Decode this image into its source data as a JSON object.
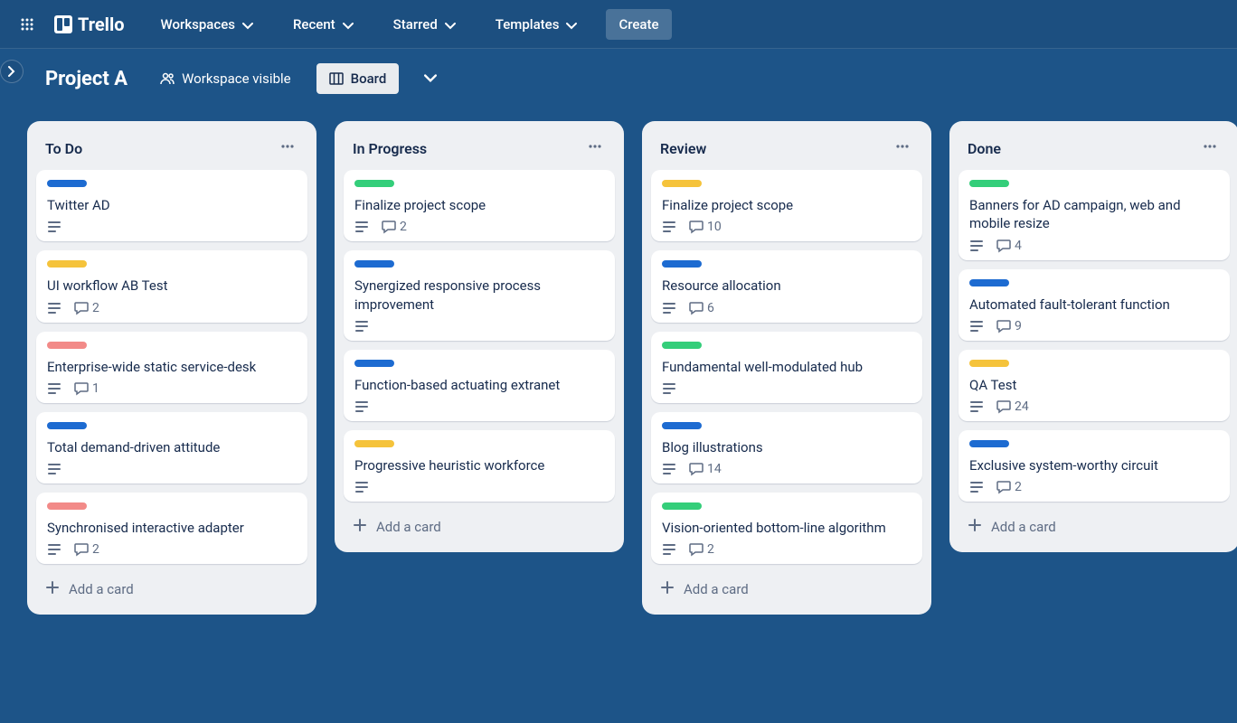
{
  "app": {
    "name": "Trello"
  },
  "topnav": {
    "workspaces": "Workspaces",
    "recent": "Recent",
    "starred": "Starred",
    "templates": "Templates",
    "create": "Create"
  },
  "board": {
    "title": "Project A",
    "visibility": "Workspace visible",
    "view_label": "Board"
  },
  "lists": [
    {
      "title": "To Do",
      "add_card_label": "Add a card",
      "cards": [
        {
          "label": "blue",
          "title": "Twitter AD",
          "has_desc": true,
          "comments": null
        },
        {
          "label": "yellow",
          "title": "UI workflow AB Test",
          "has_desc": true,
          "comments": 2
        },
        {
          "label": "red",
          "title": "Enterprise-wide static service-desk",
          "has_desc": true,
          "comments": 1
        },
        {
          "label": "blue",
          "title": "Total demand-driven attitude",
          "has_desc": true,
          "comments": null
        },
        {
          "label": "red",
          "title": "Synchronised interactive adapter",
          "has_desc": true,
          "comments": 2
        }
      ]
    },
    {
      "title": "In Progress",
      "add_card_label": "Add a card",
      "cards": [
        {
          "label": "green",
          "title": "Finalize project scope",
          "has_desc": true,
          "comments": 2
        },
        {
          "label": "blue",
          "title": "Synergized responsive process improvement",
          "has_desc": true,
          "comments": null
        },
        {
          "label": "blue",
          "title": "Function-based actuating extranet",
          "has_desc": true,
          "comments": null
        },
        {
          "label": "yellow",
          "title": "Progressive heuristic workforce",
          "has_desc": true,
          "comments": null
        }
      ]
    },
    {
      "title": "Review",
      "add_card_label": "Add a card",
      "cards": [
        {
          "label": "yellow",
          "title": "Finalize project scope",
          "has_desc": true,
          "comments": 10
        },
        {
          "label": "blue",
          "title": "Resource allocation",
          "has_desc": true,
          "comments": 6
        },
        {
          "label": "green",
          "title": "Fundamental well-modulated hub",
          "has_desc": true,
          "comments": null
        },
        {
          "label": "blue",
          "title": "Blog illustrations",
          "has_desc": true,
          "comments": 14
        },
        {
          "label": "green",
          "title": "Vision-oriented bottom-line algorithm",
          "has_desc": true,
          "comments": 2
        }
      ]
    },
    {
      "title": "Done",
      "add_card_label": "Add a card",
      "cards": [
        {
          "label": "green",
          "title": "Banners for AD campaign, web and mobile resize",
          "has_desc": true,
          "comments": 4
        },
        {
          "label": "blue",
          "title": "Automated fault-tolerant function",
          "has_desc": true,
          "comments": 9
        },
        {
          "label": "yellow",
          "title": "QA Test",
          "has_desc": true,
          "comments": 24
        },
        {
          "label": "blue",
          "title": "Exclusive system-worthy circuit",
          "has_desc": true,
          "comments": 2
        }
      ]
    }
  ]
}
